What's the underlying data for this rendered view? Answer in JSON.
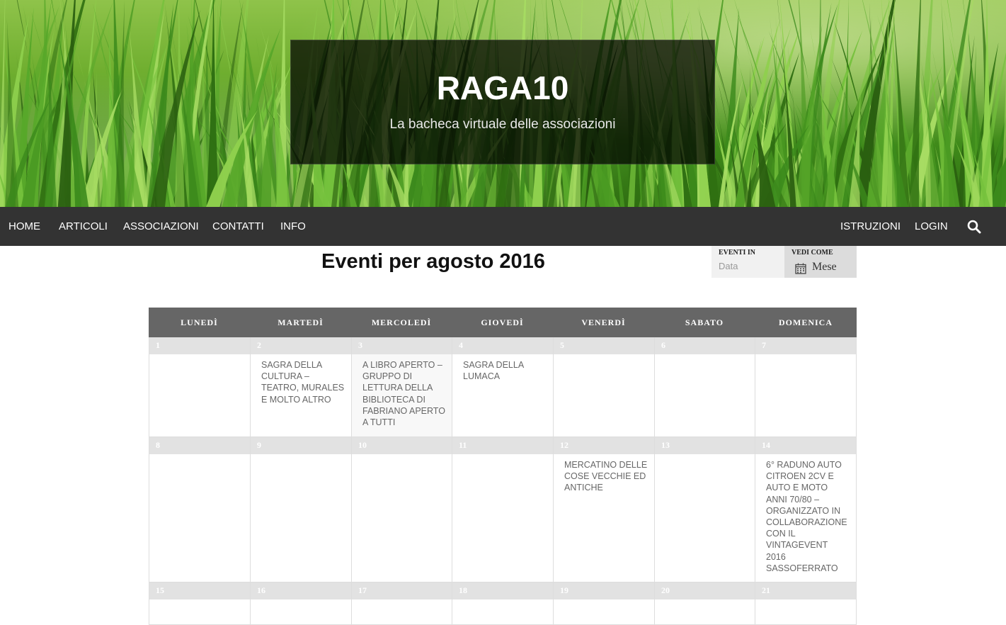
{
  "site": {
    "title": "RAGA10",
    "tagline": "La bacheca virtuale delle associazioni"
  },
  "nav": {
    "left": [
      "HOME",
      "ARTICOLI",
      "ASSOCIAZIONI",
      "CONTATTI",
      "INFO"
    ],
    "right": [
      "ISTRUZIONI",
      "LOGIN"
    ],
    "search_icon": "search-icon"
  },
  "page": {
    "heading": "Eventi per agosto 2016"
  },
  "filters": {
    "date_label": "EVENTI IN",
    "date_placeholder": "Data",
    "view_label": "VEDI COME",
    "view_value": "Mese",
    "view_icon": "calendar-icon"
  },
  "calendar": {
    "weekdays": [
      "LUNEDÌ",
      "MARTEDÌ",
      "MERCOLEDÌ",
      "GIOVEDÌ",
      "VENERDÌ",
      "SABATO",
      "DOMENICA"
    ],
    "weeks": [
      [
        {
          "day": "1",
          "events": []
        },
        {
          "day": "2",
          "events": [
            "SAGRA DELLA CULTURA – TEATRO, MURALES E MOLTO ALTRO"
          ]
        },
        {
          "day": "3",
          "events": [
            "A LIBRO APERTO – GRUPPO DI LETTURA DELLA BIBLIOTECA DI FABRIANO APERTO A TUTTI"
          ]
        },
        {
          "day": "4",
          "events": [
            "SAGRA DELLA LUMACA"
          ]
        },
        {
          "day": "5",
          "events": []
        },
        {
          "day": "6",
          "events": []
        },
        {
          "day": "7",
          "events": []
        }
      ],
      [
        {
          "day": "8",
          "events": []
        },
        {
          "day": "9",
          "events": []
        },
        {
          "day": "10",
          "events": []
        },
        {
          "day": "11",
          "events": []
        },
        {
          "day": "12",
          "events": [
            "MERCATINO DELLE COSE VECCHIE ED ANTICHE"
          ]
        },
        {
          "day": "13",
          "events": []
        },
        {
          "day": "14",
          "events": [
            "6° RADUNO AUTO CITROEN 2CV E AUTO E MOTO ANNI 70/80 – ORGANIZZATO IN COLLABORAZIONE CON IL VINTAGEVENT 2016 SASSOFERRATO"
          ]
        }
      ],
      [
        {
          "day": "15",
          "events": []
        },
        {
          "day": "16",
          "events": []
        },
        {
          "day": "17",
          "events": []
        },
        {
          "day": "18",
          "events": []
        },
        {
          "day": "19",
          "events": []
        },
        {
          "day": "20",
          "events": []
        },
        {
          "day": "21",
          "events": []
        }
      ]
    ]
  }
}
